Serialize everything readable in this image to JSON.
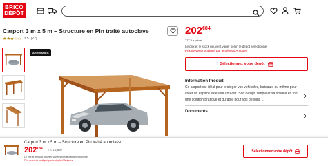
{
  "header": {
    "logo_line1": "BRICO",
    "logo_line2": "DÉPÔT",
    "search_placeholder": "",
    "icons": [
      "store-icon",
      "truck-icon",
      "search-icon",
      "heart-icon",
      "user-icon",
      "cart-icon"
    ]
  },
  "product": {
    "title": "Carport 3 m x 5 m – Structure en Pin traité autoclave",
    "stars": "★★★☆☆",
    "rating_value": "3.5",
    "rating_count": "(22)",
    "badge": "ARRIVAGES",
    "price_int": "202",
    "price_dec": "€84",
    "ttc": "TTC La pièce",
    "stock_note": "Le prix et le stock peuvent varier selon le dépôt sélectionné",
    "stock_note_red": "Prix de vente pratiqué par le dépôt d'Arrigues",
    "store_button": "Sélectionnez votre dépôt"
  },
  "info": {
    "title": "Information Produit",
    "text": "Ce carport est idéal pour protéger vos véhicules, bateaux, ou même pour créer un espace extérieur couvert. Son design simple et sa solidité en font une solution pratique et durable pour vos besoins ...",
    "docs": "Documents"
  },
  "sticky": {
    "title": "Carport 3 m x 5 m – Structure en Pin traité autoclave",
    "price_int": "202",
    "price_dec": "€84",
    "ttc": "TTC La pièce",
    "note": "Le prix et le stock peuvent varier selon le dépôt sélectionné",
    "note_red": "Prix de vente pratiqué par le dépôt d'Arrigues",
    "store_button": "Sélectionnez votre dépôt"
  },
  "colors": {
    "brand": "#e30613",
    "star": "#b8860b",
    "wood": "#b5651d"
  }
}
